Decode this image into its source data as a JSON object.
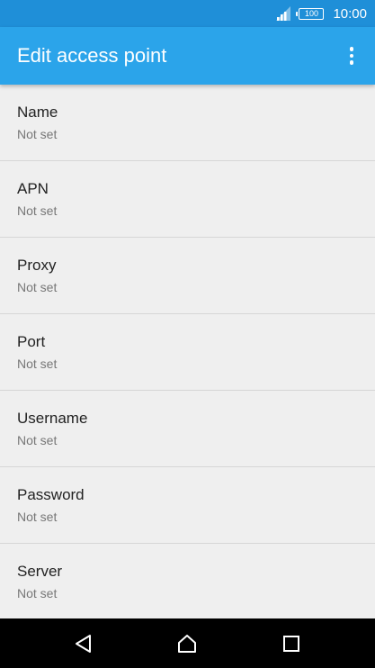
{
  "status_bar": {
    "battery_level": "100",
    "time": "10:00",
    "icons": [
      "signal-icon",
      "battery-icon"
    ]
  },
  "app_bar": {
    "title": "Edit access point",
    "menu_icon": "more-vert-icon"
  },
  "settings": [
    {
      "title": "Name",
      "summary": "Not set"
    },
    {
      "title": "APN",
      "summary": "Not set"
    },
    {
      "title": "Proxy",
      "summary": "Not set"
    },
    {
      "title": "Port",
      "summary": "Not set"
    },
    {
      "title": "Username",
      "summary": "Not set"
    },
    {
      "title": "Password",
      "summary": "Not set"
    },
    {
      "title": "Server",
      "summary": "Not set"
    }
  ],
  "nav_bar": {
    "icons": [
      "back-icon",
      "home-icon",
      "recents-icon"
    ]
  },
  "colors": {
    "status_bar": "#1f8fd8",
    "app_bar": "#2ba4ea",
    "background": "#efefef"
  }
}
